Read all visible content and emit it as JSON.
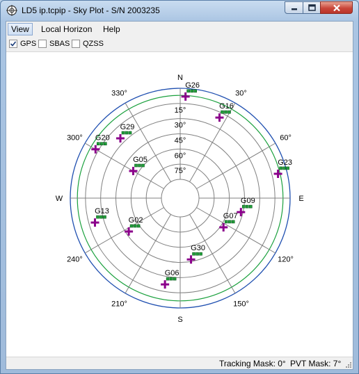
{
  "window": {
    "title": "LD5 ip.tcpip - Sky Plot - S/N 2003235"
  },
  "menu": [
    {
      "label": "View",
      "active": true
    },
    {
      "label": "Local Horizon",
      "active": false
    },
    {
      "label": "Help",
      "active": false
    }
  ],
  "filters": [
    {
      "label": "GPS",
      "checked": true
    },
    {
      "label": "SBAS",
      "checked": false
    },
    {
      "label": "QZSS",
      "checked": false
    }
  ],
  "skyplot": {
    "cardinals": {
      "N": "N",
      "E": "E",
      "S": "S",
      "W": "W"
    },
    "azimuth_labels": [
      "30°",
      "60°",
      "120°",
      "150°",
      "210°",
      "240°",
      "300°",
      "330°"
    ],
    "elevation_labels": [
      "15°",
      "30°",
      "45°",
      "60°",
      "75°"
    ],
    "colors": {
      "grid": "#808080",
      "outer": "#1f4fb0",
      "mask": "#19a03c",
      "satellite": "#8b008b",
      "signal": "#22a03a"
    }
  },
  "chart_data": {
    "type": "scatter",
    "title": "",
    "azimuth_ticks": [
      0,
      30,
      60,
      90,
      120,
      150,
      180,
      210,
      240,
      270,
      300,
      330
    ],
    "elevation_rings": [
      0,
      15,
      30,
      45,
      60,
      75
    ],
    "tracking_mask_deg": 0,
    "pvt_mask_deg": 7,
    "satellites": [
      {
        "name": "G26",
        "azimuth": 3,
        "elevation": 8
      },
      {
        "name": "G16",
        "azimuth": 26,
        "elevation": 20
      },
      {
        "name": "G23",
        "azimuth": 76,
        "elevation": 9
      },
      {
        "name": "G09",
        "azimuth": 103,
        "elevation": 47
      },
      {
        "name": "G07",
        "azimuth": 124,
        "elevation": 57
      },
      {
        "name": "G30",
        "azimuth": 170,
        "elevation": 47
      },
      {
        "name": "G06",
        "azimuth": 190,
        "elevation": 22
      },
      {
        "name": "G02",
        "azimuth": 237,
        "elevation": 48
      },
      {
        "name": "G13",
        "azimuth": 254,
        "elevation": 21
      },
      {
        "name": "G29",
        "azimuth": 315,
        "elevation": 25
      },
      {
        "name": "G20",
        "azimuth": 300,
        "elevation": 12
      },
      {
        "name": "G05",
        "azimuth": 300,
        "elevation": 55
      }
    ]
  },
  "status": {
    "tracking_mask": "Tracking Mask: 0°",
    "pvt_mask": "PVT Mask: 7°"
  }
}
